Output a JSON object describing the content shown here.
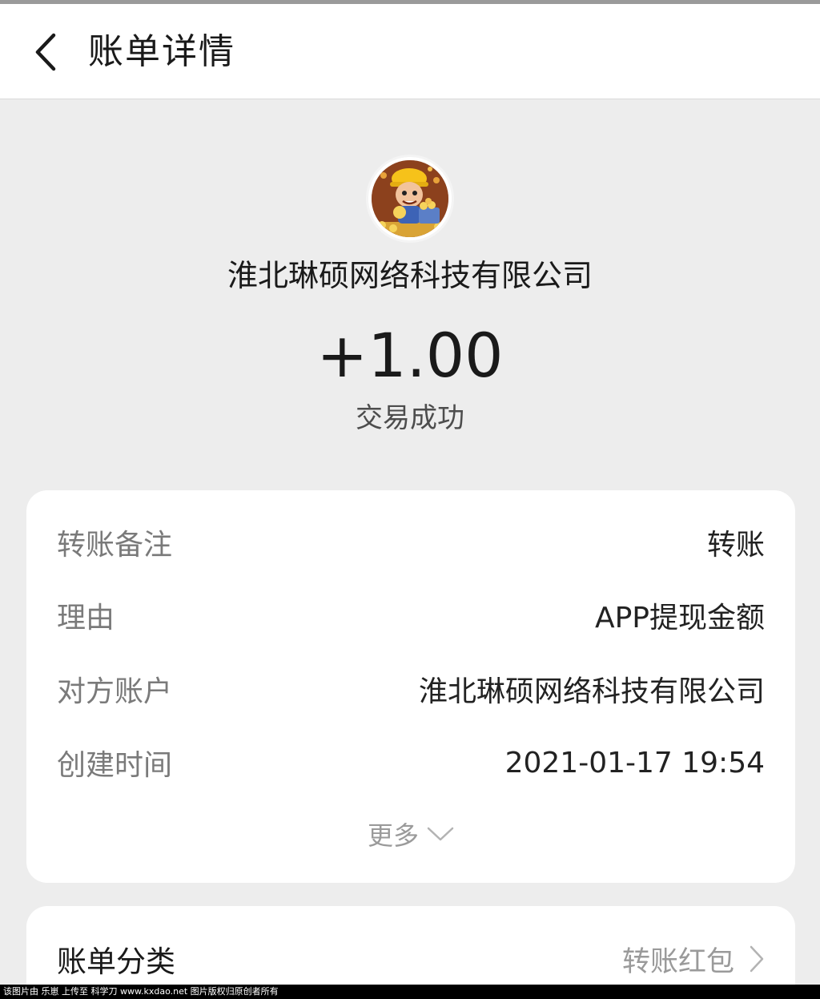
{
  "header": {
    "title": "账单详情",
    "back_icon": "chevron-left-icon"
  },
  "transaction": {
    "company": "淮北琳硕网络科技有限公司",
    "amount": "+1.00",
    "status": "交易成功",
    "avatar": "miner-avatar-icon"
  },
  "details": {
    "rows": [
      {
        "label": "转账备注",
        "value": "转账"
      },
      {
        "label": "理由",
        "value": "APP提现金额"
      },
      {
        "label": "对方账户",
        "value": "淮北琳硕网络科技有限公司"
      },
      {
        "label": "创建时间",
        "value": "2021-01-17 19:54"
      }
    ],
    "more_label": "更多"
  },
  "category": {
    "label": "账单分类",
    "value": "转账红包"
  },
  "watermark": "该图片由 乐崽 上传至 科学刀 www.kxdao.net 图片版权归原创者所有",
  "colors": {
    "background": "#ededed",
    "card": "#ffffff",
    "label_gray": "#7a7a7a"
  }
}
